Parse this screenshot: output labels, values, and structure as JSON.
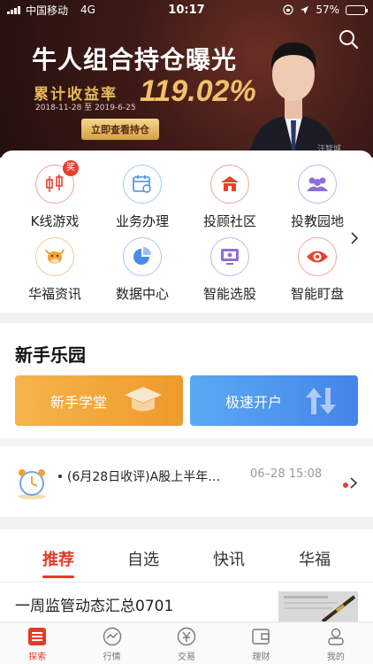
{
  "status_bar": {
    "carrier": "中国移动",
    "network": "4G",
    "time": "10:17",
    "battery": "57%",
    "battery_level": 0.57
  },
  "banner": {
    "title": "牛人组合持仓曝光",
    "subtitle": "累计收益率",
    "rate": "119.02%",
    "date_range": "2018-11-28 至 2019-6-25",
    "button": "立即查看持仓",
    "person_tag": "汪智城"
  },
  "grid": {
    "items": [
      {
        "label": "K线游戏",
        "icon": "candlestick-icon",
        "color": "#e9412f",
        "badge": "奖"
      },
      {
        "label": "业务办理",
        "icon": "calendar-icon",
        "color": "#4a8ce8"
      },
      {
        "label": "投顾社区",
        "icon": "house-icon",
        "color": "#e9412f"
      },
      {
        "label": "投教园地",
        "icon": "people-icon",
        "color": "#8c6fd8"
      },
      {
        "label": "华福资讯",
        "icon": "cow-icon",
        "color": "#f0a23a"
      },
      {
        "label": "数据中心",
        "icon": "pie-chart-icon",
        "color": "#4a8ce8"
      },
      {
        "label": "智能选股",
        "icon": "monitor-icon",
        "color": "#8c6fd8"
      },
      {
        "label": "智能盯盘",
        "icon": "eye-icon",
        "color": "#e9412f"
      }
    ]
  },
  "novice": {
    "title": "新手乐园",
    "left_button": "新手学堂",
    "right_button": "极速开户"
  },
  "ticker": {
    "text": "(6月28日收评)A股上半年…",
    "time": "06–28 15:08"
  },
  "tabs": [
    "推荐",
    "自选",
    "快讯",
    "华福"
  ],
  "article": {
    "title": "一周监管动态汇总0701"
  },
  "bottom_nav": [
    {
      "label": "探索",
      "icon": "explore-icon",
      "active": true
    },
    {
      "label": "行情",
      "icon": "chart-line-icon"
    },
    {
      "label": "交易",
      "icon": "trade-icon"
    },
    {
      "label": "理财",
      "icon": "wallet-icon"
    },
    {
      "label": "我的",
      "icon": "profile-icon"
    }
  ],
  "colors": {
    "accent": "#e33a28",
    "gold": "#e7b858",
    "blue": "#4a8ce8",
    "orange": "#ee9a2c"
  }
}
